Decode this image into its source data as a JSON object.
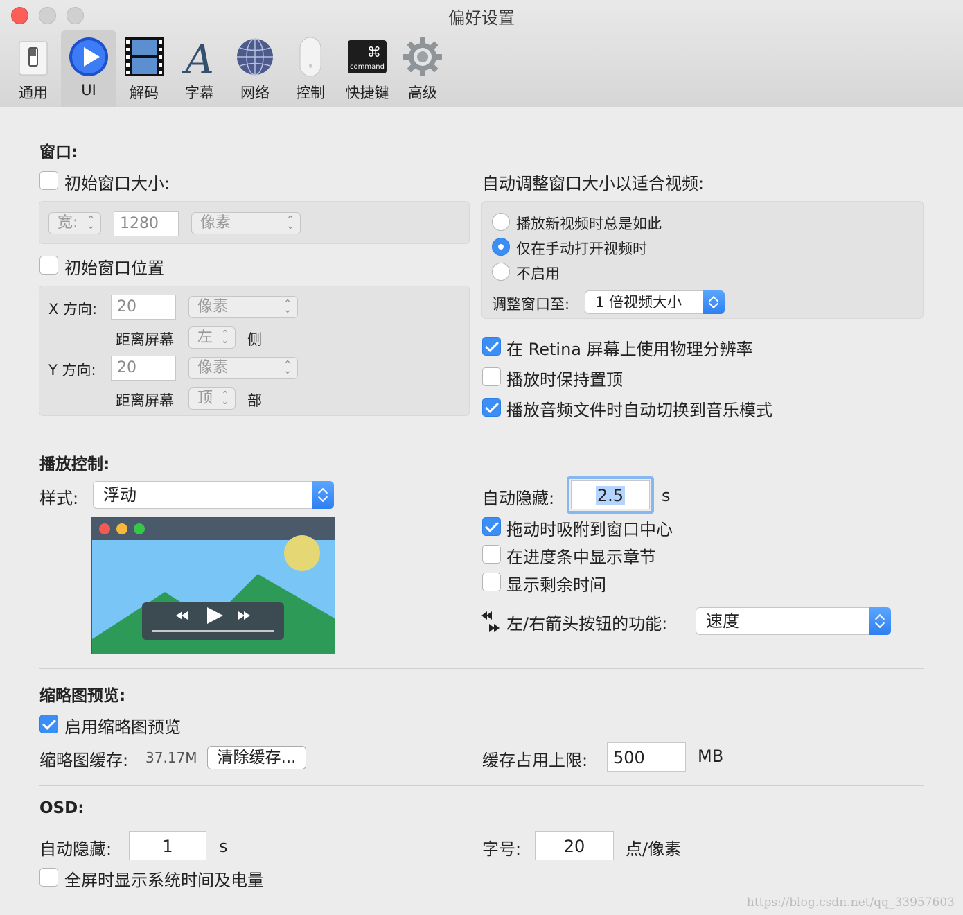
{
  "window": {
    "title": "偏好设置"
  },
  "toolbar": [
    {
      "label": "通用",
      "icon": "switch-icon"
    },
    {
      "label": "UI",
      "icon": "play-icon",
      "selected": true
    },
    {
      "label": "解码",
      "icon": "film-icon"
    },
    {
      "label": "字幕",
      "icon": "font-icon"
    },
    {
      "label": "网络",
      "icon": "globe-icon"
    },
    {
      "label": "控制",
      "icon": "mouse-icon"
    },
    {
      "label": "快捷键",
      "icon": "command-key-icon",
      "key_symbol": "⌘",
      "key_text": "command"
    },
    {
      "label": "高级",
      "icon": "gear-icon"
    }
  ],
  "window_section": {
    "heading": "窗口:",
    "initial_size": {
      "label": "初始窗口大小:",
      "checked": false,
      "dim_label": "宽:",
      "value": "1280",
      "unit": "像素"
    },
    "initial_position": {
      "label": "初始窗口位置",
      "checked": false,
      "x_label": "X 方向:",
      "x_value": "20",
      "x_unit": "像素",
      "x_from": "距离屏幕",
      "x_side": "左",
      "x_suffix": "侧",
      "y_label": "Y 方向:",
      "y_value": "20",
      "y_unit": "像素",
      "y_from": "距离屏幕",
      "y_side": "顶",
      "y_suffix": "部"
    },
    "auto_resize": {
      "label": "自动调整窗口大小以适合视频:",
      "options": [
        "播放新视频时总是如此",
        "仅在手动打开视频时",
        "不启用"
      ],
      "selected_index": 1,
      "resize_to_label": "调整窗口至:",
      "resize_to_value": "1 倍视频大小"
    },
    "retina": {
      "label": "在 Retina 屏幕上使用物理分辨率",
      "checked": true
    },
    "keep_on_top": {
      "label": "播放时保持置顶",
      "checked": false
    },
    "audio_music_mode": {
      "label": "播放音频文件时自动切换到音乐模式",
      "checked": true
    }
  },
  "playback": {
    "heading": "播放控制:",
    "style_label": "样式:",
    "style_value": "浮动",
    "autohide_label": "自动隐藏:",
    "autohide_value": "2.5",
    "autohide_unit": "s",
    "snap": {
      "label": "拖动时吸附到窗口中心",
      "checked": true
    },
    "chapters": {
      "label": "在进度条中显示章节",
      "checked": false
    },
    "remaining": {
      "label": "显示剩余时间",
      "checked": false
    },
    "arrow_label": "左/右箭头按钮的功能:",
    "arrow_value": "速度"
  },
  "thumbnail": {
    "heading": "缩略图预览:",
    "enable": {
      "label": "启用缩略图预览",
      "checked": true
    },
    "cache_label": "缩略图缓存:",
    "cache_size": "37.17M",
    "clear_button": "清除缓存...",
    "limit_label": "缓存占用上限:",
    "limit_value": "500",
    "limit_unit": "MB"
  },
  "osd": {
    "heading": "OSD:",
    "autohide_label": "自动隐藏:",
    "autohide_value": "1",
    "autohide_unit": "s",
    "font_label": "字号:",
    "font_value": "20",
    "font_unit": "点/像素",
    "fullscreen": {
      "label": "全屏时显示系统时间及电量",
      "checked": false
    }
  },
  "watermark": "https://blog.csdn.net/qq_33957603"
}
